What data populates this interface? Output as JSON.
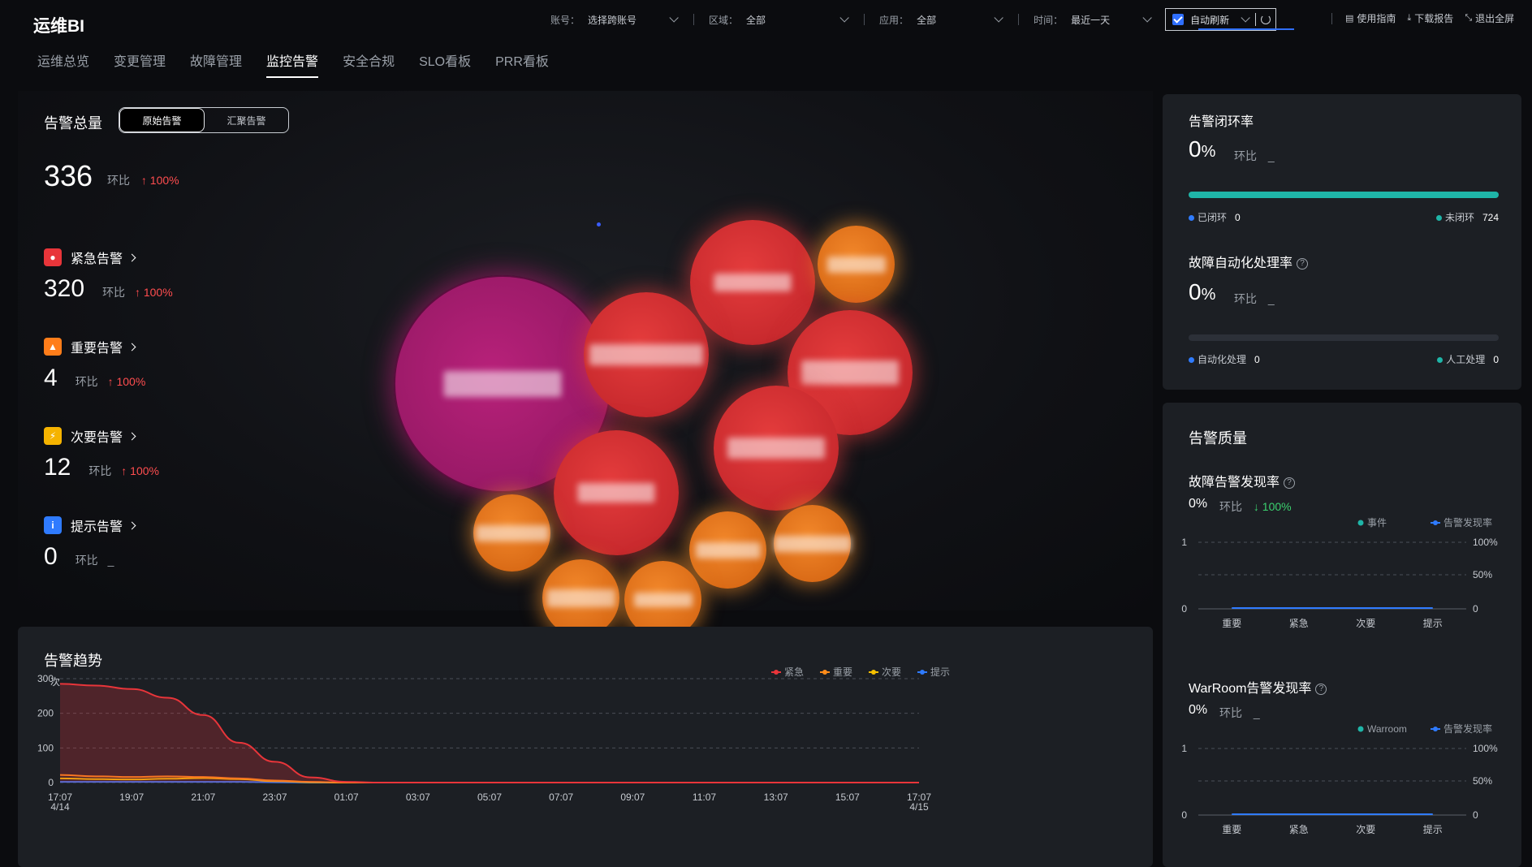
{
  "brand": "运维BI",
  "filters": [
    {
      "label": "账号：",
      "value": "选择跨账号"
    },
    {
      "label": "区域：",
      "value": "全部"
    },
    {
      "label": "应用：",
      "value": "全部"
    },
    {
      "label": "时间：",
      "value": "最近一天"
    }
  ],
  "auto_refresh": {
    "label": "自动刷新",
    "checked": true
  },
  "actions": [
    {
      "label": "使用指南",
      "icon": "guide-icon"
    },
    {
      "label": "下载报告",
      "icon": "download-icon"
    },
    {
      "label": "退出全屏",
      "icon": "exit-fullscreen-icon"
    }
  ],
  "tabs": [
    "运维总览",
    "变更管理",
    "故障管理",
    "监控告警",
    "安全合规",
    "SLO看板",
    "PRR看板"
  ],
  "active_tab": "监控告警",
  "overview": {
    "title": "告警总量",
    "segments": [
      "原始告警",
      "汇聚告警"
    ],
    "active_segment": "原始告警",
    "total": "336",
    "cmp_label": "环比",
    "total_change": "100%",
    "severities": [
      {
        "name": "紧急告警",
        "value": "320",
        "change": "100%",
        "color": "#e8353a",
        "glyph": "🔥"
      },
      {
        "name": "重要告警",
        "value": "4",
        "change": "100%",
        "color": "#ff7d1a",
        "glyph": "▲"
      },
      {
        "name": "次要告警",
        "value": "12",
        "change": "100%",
        "color": "#f5b300",
        "glyph": "⚡"
      },
      {
        "name": "提示告警",
        "value": "0",
        "change": "_",
        "color": "#2f7bff",
        "glyph": "i"
      }
    ]
  },
  "trend": {
    "title": "告警趋势",
    "unit": "次",
    "legend": [
      {
        "name": "紧急",
        "color": "#e8353a"
      },
      {
        "name": "重要",
        "color": "#ff8c1a"
      },
      {
        "name": "次要",
        "color": "#f5c000"
      },
      {
        "name": "提示",
        "color": "#2f7bff"
      }
    ]
  },
  "chart_data": [
    {
      "type": "area",
      "title": "告警趋势",
      "ylabel": "次",
      "ylim": [
        0,
        300
      ],
      "yticks": [
        0,
        100,
        200,
        300
      ],
      "x_tick_labels": [
        "17:07\n4/14",
        "19:07",
        "21:07",
        "23:07",
        "01:07",
        "03:07",
        "05:07",
        "07:07",
        "09:07",
        "11:07",
        "13:07",
        "15:07",
        "17:07\n4/15"
      ],
      "x": [
        0,
        1,
        2,
        3,
        4,
        5,
        6,
        7,
        8,
        9,
        10,
        11,
        12,
        13,
        14,
        15,
        16,
        17,
        18,
        19,
        20,
        21,
        22,
        23,
        24
      ],
      "series": [
        {
          "name": "紧急",
          "color": "#e8353a",
          "values": [
            285,
            280,
            270,
            245,
            195,
            115,
            60,
            15,
            2,
            0,
            0,
            0,
            0,
            0,
            0,
            0,
            0,
            0,
            0,
            0,
            0,
            0,
            0,
            0,
            0
          ]
        },
        {
          "name": "重要",
          "color": "#ff8c1a",
          "values": [
            22,
            18,
            16,
            18,
            16,
            12,
            6,
            2,
            0,
            0,
            0,
            0,
            0,
            0,
            0,
            0,
            0,
            0,
            0,
            0,
            0,
            0,
            0,
            0,
            0
          ]
        },
        {
          "name": "次要",
          "color": "#f5c000",
          "values": [
            12,
            10,
            9,
            11,
            13,
            10,
            4,
            1,
            0,
            0,
            0,
            0,
            0,
            0,
            0,
            0,
            0,
            0,
            0,
            0,
            0,
            0,
            0,
            0,
            0
          ]
        },
        {
          "name": "提示",
          "color": "#2f7bff",
          "values": [
            2,
            2,
            2,
            2,
            2,
            2,
            1,
            0,
            0,
            0,
            0,
            0,
            0,
            0,
            0,
            0,
            0,
            0,
            0,
            0,
            0,
            0,
            0,
            0,
            0
          ]
        }
      ],
      "grid": true,
      "legend_position": "top-right"
    },
    {
      "type": "bar",
      "title": "故障告警发现率",
      "categories": [
        "重要",
        "紧急",
        "次要",
        "提示"
      ],
      "series": [
        {
          "name": "事件",
          "color": "#1fb5a8",
          "values": [
            0,
            0,
            0,
            0
          ]
        },
        {
          "name": "告警发现率",
          "color": "#2f7bff",
          "values": [
            0,
            0,
            0,
            0
          ]
        }
      ],
      "ylim_left": [
        0,
        1
      ],
      "ylim_right": [
        "0",
        "50%",
        "100%"
      ]
    },
    {
      "type": "bar",
      "title": "WarRoom告警发现率",
      "categories": [
        "重要",
        "紧急",
        "次要",
        "提示"
      ],
      "series": [
        {
          "name": "Warroom",
          "color": "#1fb5a8",
          "values": [
            0,
            0,
            0,
            0
          ]
        },
        {
          "name": "告警发现率",
          "color": "#2f7bff",
          "values": [
            0,
            0,
            0,
            0
          ]
        }
      ],
      "ylim_left": [
        0,
        1
      ],
      "ylim_right": [
        "0",
        "50%",
        "100%"
      ]
    }
  ],
  "closure": {
    "title": "告警闭环率",
    "value": "0",
    "pct": "%",
    "cmp_label": "环比",
    "cmp_value": "_",
    "rate": 0,
    "closed_label": "已闭环",
    "closed_value": "0",
    "open_label": "未闭环",
    "open_value": "724",
    "closed_color": "#2f7bff",
    "open_color": "#1fb5a8"
  },
  "automation": {
    "title": "故障自动化处理率",
    "value": "0",
    "pct": "%",
    "cmp_label": "环比",
    "cmp_value": "_",
    "auto_label": "自动化处理",
    "auto_value": "0",
    "manual_label": "人工处理",
    "manual_value": "0"
  },
  "quality": {
    "title": "告警质量",
    "fault": {
      "title": "故障告警发现率",
      "value": "0%",
      "cmp_label": "环比",
      "change": "100%"
    },
    "warroom": {
      "title": "WarRoom告警发现率",
      "value": "0%",
      "cmp_label": "环比",
      "change": "_"
    }
  }
}
